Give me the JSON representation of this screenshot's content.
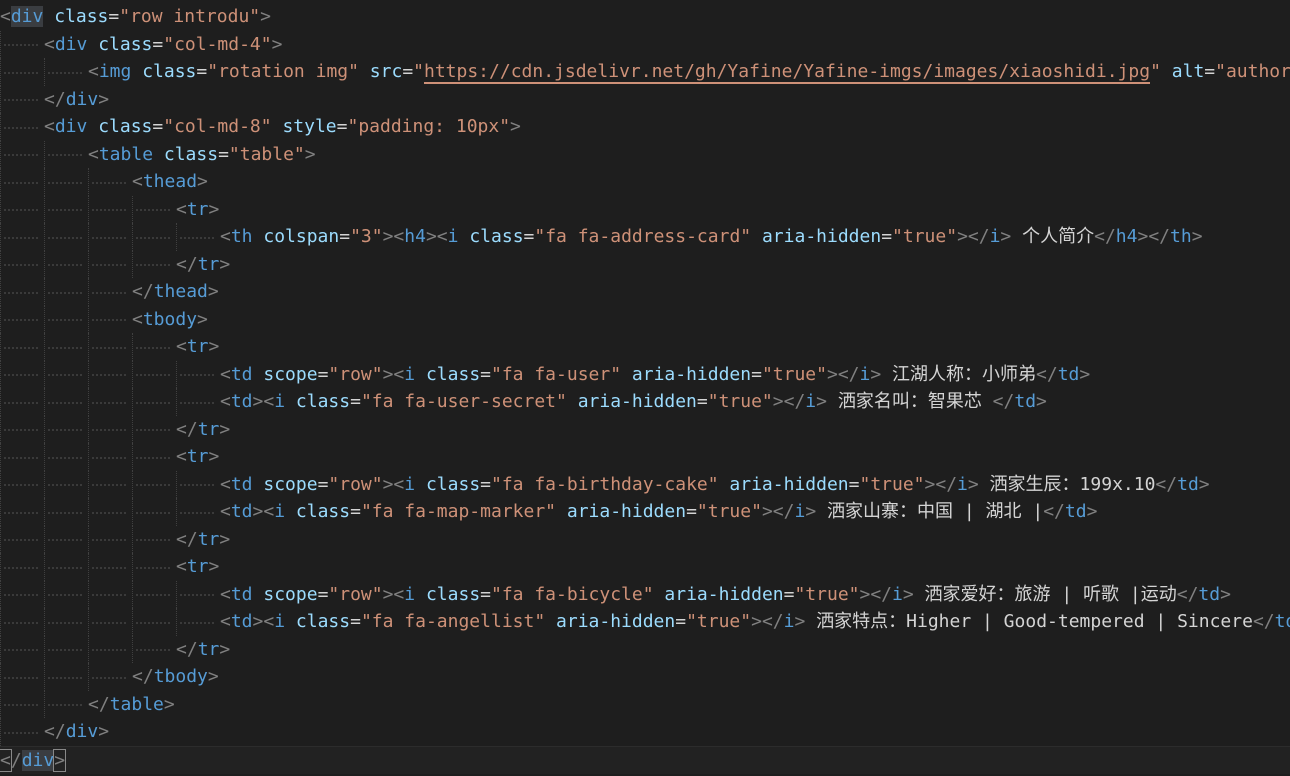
{
  "editor": {
    "language": "html",
    "current_line": 28,
    "lines": [
      {
        "indent": 0,
        "tokens": [
          {
            "t": "p",
            "v": "<"
          },
          {
            "t": "t",
            "v": "div",
            "hl": true
          },
          {
            "t": "x",
            "v": " "
          },
          {
            "t": "a",
            "v": "class"
          },
          {
            "t": "x",
            "v": "="
          },
          {
            "t": "s",
            "v": "\"row introdu\""
          },
          {
            "t": "p",
            "v": ">"
          }
        ]
      },
      {
        "indent": 1,
        "tokens": [
          {
            "t": "p",
            "v": "<"
          },
          {
            "t": "t",
            "v": "div"
          },
          {
            "t": "x",
            "v": " "
          },
          {
            "t": "a",
            "v": "class"
          },
          {
            "t": "x",
            "v": "="
          },
          {
            "t": "s",
            "v": "\"col-md-4\""
          },
          {
            "t": "p",
            "v": ">"
          }
        ]
      },
      {
        "indent": 2,
        "tokens": [
          {
            "t": "p",
            "v": "<"
          },
          {
            "t": "t",
            "v": "img"
          },
          {
            "t": "x",
            "v": " "
          },
          {
            "t": "a",
            "v": "class"
          },
          {
            "t": "x",
            "v": "="
          },
          {
            "t": "s",
            "v": "\"rotation img\""
          },
          {
            "t": "x",
            "v": " "
          },
          {
            "t": "a",
            "v": "src"
          },
          {
            "t": "x",
            "v": "="
          },
          {
            "t": "s",
            "v": "\""
          },
          {
            "t": "u",
            "v": "https://cdn.jsdelivr.net/gh/Yafine/Yafine-imgs/images/xiaoshidi.jpg"
          },
          {
            "t": "s",
            "v": "\""
          },
          {
            "t": "x",
            "v": " "
          },
          {
            "t": "a",
            "v": "alt"
          },
          {
            "t": "x",
            "v": "="
          },
          {
            "t": "s",
            "v": "\"author\""
          },
          {
            "t": "p",
            "v": ">"
          }
        ]
      },
      {
        "indent": 1,
        "tokens": [
          {
            "t": "p",
            "v": "</"
          },
          {
            "t": "t",
            "v": "div"
          },
          {
            "t": "p",
            "v": ">"
          }
        ]
      },
      {
        "indent": 1,
        "tokens": [
          {
            "t": "p",
            "v": "<"
          },
          {
            "t": "t",
            "v": "div"
          },
          {
            "t": "x",
            "v": " "
          },
          {
            "t": "a",
            "v": "class"
          },
          {
            "t": "x",
            "v": "="
          },
          {
            "t": "s",
            "v": "\"col-md-8\""
          },
          {
            "t": "x",
            "v": " "
          },
          {
            "t": "a",
            "v": "style"
          },
          {
            "t": "x",
            "v": "="
          },
          {
            "t": "s",
            "v": "\"padding: 10px\""
          },
          {
            "t": "p",
            "v": ">"
          }
        ]
      },
      {
        "indent": 2,
        "tokens": [
          {
            "t": "p",
            "v": "<"
          },
          {
            "t": "t",
            "v": "table"
          },
          {
            "t": "x",
            "v": " "
          },
          {
            "t": "a",
            "v": "class"
          },
          {
            "t": "x",
            "v": "="
          },
          {
            "t": "s",
            "v": "\"table\""
          },
          {
            "t": "p",
            "v": ">"
          }
        ]
      },
      {
        "indent": 3,
        "tokens": [
          {
            "t": "p",
            "v": "<"
          },
          {
            "t": "t",
            "v": "thead"
          },
          {
            "t": "p",
            "v": ">"
          }
        ]
      },
      {
        "indent": 4,
        "tokens": [
          {
            "t": "p",
            "v": "<"
          },
          {
            "t": "t",
            "v": "tr"
          },
          {
            "t": "p",
            "v": ">"
          }
        ]
      },
      {
        "indent": 5,
        "tokens": [
          {
            "t": "p",
            "v": "<"
          },
          {
            "t": "t",
            "v": "th"
          },
          {
            "t": "x",
            "v": " "
          },
          {
            "t": "a",
            "v": "colspan"
          },
          {
            "t": "x",
            "v": "="
          },
          {
            "t": "s",
            "v": "\"3\""
          },
          {
            "t": "p",
            "v": "><"
          },
          {
            "t": "t",
            "v": "h4"
          },
          {
            "t": "p",
            "v": "><"
          },
          {
            "t": "t",
            "v": "i"
          },
          {
            "t": "x",
            "v": " "
          },
          {
            "t": "a",
            "v": "class"
          },
          {
            "t": "x",
            "v": "="
          },
          {
            "t": "s",
            "v": "\"fa fa-address-card\""
          },
          {
            "t": "x",
            "v": " "
          },
          {
            "t": "a",
            "v": "aria-hidden"
          },
          {
            "t": "x",
            "v": "="
          },
          {
            "t": "s",
            "v": "\"true\""
          },
          {
            "t": "p",
            "v": "></"
          },
          {
            "t": "t",
            "v": "i"
          },
          {
            "t": "p",
            "v": ">"
          },
          {
            "t": "x",
            "v": " 个人简介"
          },
          {
            "t": "p",
            "v": "</"
          },
          {
            "t": "t",
            "v": "h4"
          },
          {
            "t": "p",
            "v": "></"
          },
          {
            "t": "t",
            "v": "th"
          },
          {
            "t": "p",
            "v": ">"
          }
        ]
      },
      {
        "indent": 4,
        "tokens": [
          {
            "t": "p",
            "v": "</"
          },
          {
            "t": "t",
            "v": "tr"
          },
          {
            "t": "p",
            "v": ">"
          }
        ]
      },
      {
        "indent": 3,
        "tokens": [
          {
            "t": "p",
            "v": "</"
          },
          {
            "t": "t",
            "v": "thead"
          },
          {
            "t": "p",
            "v": ">"
          }
        ]
      },
      {
        "indent": 3,
        "tokens": [
          {
            "t": "p",
            "v": "<"
          },
          {
            "t": "t",
            "v": "tbody"
          },
          {
            "t": "p",
            "v": ">"
          }
        ]
      },
      {
        "indent": 4,
        "tokens": [
          {
            "t": "p",
            "v": "<"
          },
          {
            "t": "t",
            "v": "tr"
          },
          {
            "t": "p",
            "v": ">"
          }
        ]
      },
      {
        "indent": 5,
        "tokens": [
          {
            "t": "p",
            "v": "<"
          },
          {
            "t": "t",
            "v": "td"
          },
          {
            "t": "x",
            "v": " "
          },
          {
            "t": "a",
            "v": "scope"
          },
          {
            "t": "x",
            "v": "="
          },
          {
            "t": "s",
            "v": "\"row\""
          },
          {
            "t": "p",
            "v": "><"
          },
          {
            "t": "t",
            "v": "i"
          },
          {
            "t": "x",
            "v": " "
          },
          {
            "t": "a",
            "v": "class"
          },
          {
            "t": "x",
            "v": "="
          },
          {
            "t": "s",
            "v": "\"fa fa-user\""
          },
          {
            "t": "x",
            "v": " "
          },
          {
            "t": "a",
            "v": "aria-hidden"
          },
          {
            "t": "x",
            "v": "="
          },
          {
            "t": "s",
            "v": "\"true\""
          },
          {
            "t": "p",
            "v": "></"
          },
          {
            "t": "t",
            "v": "i"
          },
          {
            "t": "p",
            "v": ">"
          },
          {
            "t": "x",
            "v": " 江湖人称：小师弟"
          },
          {
            "t": "p",
            "v": "</"
          },
          {
            "t": "t",
            "v": "td"
          },
          {
            "t": "p",
            "v": ">"
          }
        ]
      },
      {
        "indent": 5,
        "tokens": [
          {
            "t": "p",
            "v": "<"
          },
          {
            "t": "t",
            "v": "td"
          },
          {
            "t": "p",
            "v": "><"
          },
          {
            "t": "t",
            "v": "i"
          },
          {
            "t": "x",
            "v": " "
          },
          {
            "t": "a",
            "v": "class"
          },
          {
            "t": "x",
            "v": "="
          },
          {
            "t": "s",
            "v": "\"fa fa-user-secret\""
          },
          {
            "t": "x",
            "v": " "
          },
          {
            "t": "a",
            "v": "aria-hidden"
          },
          {
            "t": "x",
            "v": "="
          },
          {
            "t": "s",
            "v": "\"true\""
          },
          {
            "t": "p",
            "v": "></"
          },
          {
            "t": "t",
            "v": "i"
          },
          {
            "t": "p",
            "v": ">"
          },
          {
            "t": "x",
            "v": " 洒家名叫：智果芯 "
          },
          {
            "t": "p",
            "v": "</"
          },
          {
            "t": "t",
            "v": "td"
          },
          {
            "t": "p",
            "v": ">"
          }
        ]
      },
      {
        "indent": 4,
        "tokens": [
          {
            "t": "p",
            "v": "</"
          },
          {
            "t": "t",
            "v": "tr"
          },
          {
            "t": "p",
            "v": ">"
          }
        ]
      },
      {
        "indent": 4,
        "tokens": [
          {
            "t": "p",
            "v": "<"
          },
          {
            "t": "t",
            "v": "tr"
          },
          {
            "t": "p",
            "v": ">"
          }
        ]
      },
      {
        "indent": 5,
        "tokens": [
          {
            "t": "p",
            "v": "<"
          },
          {
            "t": "t",
            "v": "td"
          },
          {
            "t": "x",
            "v": " "
          },
          {
            "t": "a",
            "v": "scope"
          },
          {
            "t": "x",
            "v": "="
          },
          {
            "t": "s",
            "v": "\"row\""
          },
          {
            "t": "p",
            "v": "><"
          },
          {
            "t": "t",
            "v": "i"
          },
          {
            "t": "x",
            "v": " "
          },
          {
            "t": "a",
            "v": "class"
          },
          {
            "t": "x",
            "v": "="
          },
          {
            "t": "s",
            "v": "\"fa fa-birthday-cake\""
          },
          {
            "t": "x",
            "v": " "
          },
          {
            "t": "a",
            "v": "aria-hidden"
          },
          {
            "t": "x",
            "v": "="
          },
          {
            "t": "s",
            "v": "\"true\""
          },
          {
            "t": "p",
            "v": "></"
          },
          {
            "t": "t",
            "v": "i"
          },
          {
            "t": "p",
            "v": ">"
          },
          {
            "t": "x",
            "v": " 洒家生辰：199x.10"
          },
          {
            "t": "p",
            "v": "</"
          },
          {
            "t": "t",
            "v": "td"
          },
          {
            "t": "p",
            "v": ">"
          }
        ]
      },
      {
        "indent": 5,
        "tokens": [
          {
            "t": "p",
            "v": "<"
          },
          {
            "t": "t",
            "v": "td"
          },
          {
            "t": "p",
            "v": "><"
          },
          {
            "t": "t",
            "v": "i"
          },
          {
            "t": "x",
            "v": " "
          },
          {
            "t": "a",
            "v": "class"
          },
          {
            "t": "x",
            "v": "="
          },
          {
            "t": "s",
            "v": "\"fa fa-map-marker\""
          },
          {
            "t": "x",
            "v": " "
          },
          {
            "t": "a",
            "v": "aria-hidden"
          },
          {
            "t": "x",
            "v": "="
          },
          {
            "t": "s",
            "v": "\"true\""
          },
          {
            "t": "p",
            "v": "></"
          },
          {
            "t": "t",
            "v": "i"
          },
          {
            "t": "p",
            "v": ">"
          },
          {
            "t": "x",
            "v": " 洒家山寨：中国 | 湖北 |"
          },
          {
            "t": "p",
            "v": "</"
          },
          {
            "t": "t",
            "v": "td"
          },
          {
            "t": "p",
            "v": ">"
          }
        ]
      },
      {
        "indent": 4,
        "tokens": [
          {
            "t": "p",
            "v": "</"
          },
          {
            "t": "t",
            "v": "tr"
          },
          {
            "t": "p",
            "v": ">"
          }
        ]
      },
      {
        "indent": 4,
        "tokens": [
          {
            "t": "p",
            "v": "<"
          },
          {
            "t": "t",
            "v": "tr"
          },
          {
            "t": "p",
            "v": ">"
          }
        ]
      },
      {
        "indent": 5,
        "tokens": [
          {
            "t": "p",
            "v": "<"
          },
          {
            "t": "t",
            "v": "td"
          },
          {
            "t": "x",
            "v": " "
          },
          {
            "t": "a",
            "v": "scope"
          },
          {
            "t": "x",
            "v": "="
          },
          {
            "t": "s",
            "v": "\"row\""
          },
          {
            "t": "p",
            "v": "><"
          },
          {
            "t": "t",
            "v": "i"
          },
          {
            "t": "x",
            "v": " "
          },
          {
            "t": "a",
            "v": "class"
          },
          {
            "t": "x",
            "v": "="
          },
          {
            "t": "s",
            "v": "\"fa fa-bicycle\""
          },
          {
            "t": "x",
            "v": " "
          },
          {
            "t": "a",
            "v": "aria-hidden"
          },
          {
            "t": "x",
            "v": "="
          },
          {
            "t": "s",
            "v": "\"true\""
          },
          {
            "t": "p",
            "v": "></"
          },
          {
            "t": "t",
            "v": "i"
          },
          {
            "t": "p",
            "v": ">"
          },
          {
            "t": "x",
            "v": " 洒家爱好：旅游 | 听歌 |运动"
          },
          {
            "t": "p",
            "v": "</"
          },
          {
            "t": "t",
            "v": "td"
          },
          {
            "t": "p",
            "v": ">"
          }
        ]
      },
      {
        "indent": 5,
        "tokens": [
          {
            "t": "p",
            "v": "<"
          },
          {
            "t": "t",
            "v": "td"
          },
          {
            "t": "p",
            "v": "><"
          },
          {
            "t": "t",
            "v": "i"
          },
          {
            "t": "x",
            "v": " "
          },
          {
            "t": "a",
            "v": "class"
          },
          {
            "t": "x",
            "v": "="
          },
          {
            "t": "s",
            "v": "\"fa fa-angellist\""
          },
          {
            "t": "x",
            "v": " "
          },
          {
            "t": "a",
            "v": "aria-hidden"
          },
          {
            "t": "x",
            "v": "="
          },
          {
            "t": "s",
            "v": "\"true\""
          },
          {
            "t": "p",
            "v": "></"
          },
          {
            "t": "t",
            "v": "i"
          },
          {
            "t": "p",
            "v": ">"
          },
          {
            "t": "x",
            "v": " 洒家特点：Higher | Good-tempered | Sincere"
          },
          {
            "t": "p",
            "v": "</"
          },
          {
            "t": "t",
            "v": "td"
          },
          {
            "t": "p",
            "v": ">"
          }
        ]
      },
      {
        "indent": 4,
        "tokens": [
          {
            "t": "p",
            "v": "</"
          },
          {
            "t": "t",
            "v": "tr"
          },
          {
            "t": "p",
            "v": ">"
          }
        ]
      },
      {
        "indent": 3,
        "tokens": [
          {
            "t": "p",
            "v": "</"
          },
          {
            "t": "t",
            "v": "tbody"
          },
          {
            "t": "p",
            "v": ">"
          }
        ]
      },
      {
        "indent": 2,
        "tokens": [
          {
            "t": "p",
            "v": "</"
          },
          {
            "t": "t",
            "v": "table"
          },
          {
            "t": "p",
            "v": ">"
          }
        ]
      },
      {
        "indent": 1,
        "tokens": [
          {
            "t": "p",
            "v": "</"
          },
          {
            "t": "t",
            "v": "div"
          },
          {
            "t": "p",
            "v": ">"
          }
        ]
      },
      {
        "indent": 0,
        "tokens": [
          {
            "t": "p",
            "v": "<",
            "bm": true
          },
          {
            "t": "p",
            "v": "/"
          },
          {
            "t": "t",
            "v": "div",
            "hl": true
          },
          {
            "t": "p",
            "v": ">",
            "bm": true
          }
        ]
      }
    ]
  }
}
